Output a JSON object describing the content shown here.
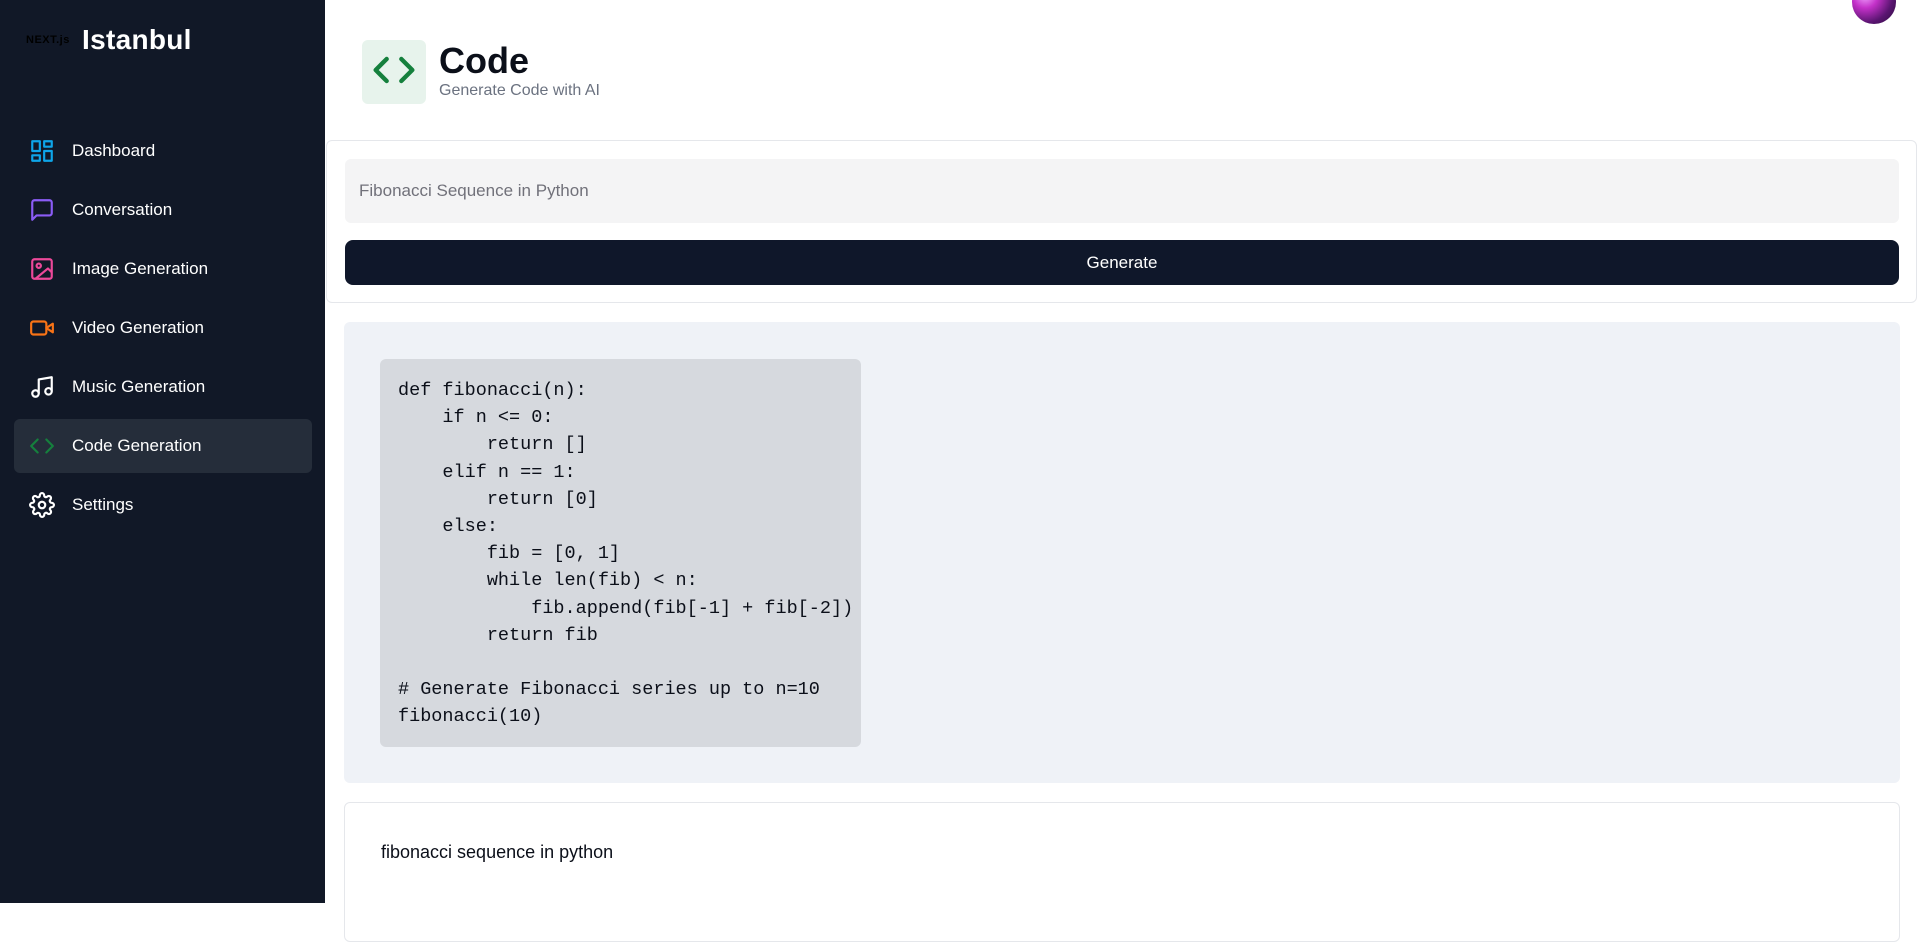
{
  "brand": {
    "logo_text": "NEXT.js",
    "name": "Istanbul"
  },
  "sidebar": {
    "items": [
      {
        "label": "Dashboard",
        "icon": "dashboard-icon",
        "color": "#0ea5e9",
        "active": false
      },
      {
        "label": "Conversation",
        "icon": "message-square-icon",
        "color": "#8b5cf6",
        "active": false
      },
      {
        "label": "Image Generation",
        "icon": "image-icon",
        "color": "#ec4899",
        "active": false
      },
      {
        "label": "Video Generation",
        "icon": "video-icon",
        "color": "#f97316",
        "active": false
      },
      {
        "label": "Music Generation",
        "icon": "music-icon",
        "color": "#ffffff",
        "active": false
      },
      {
        "label": "Code Generation",
        "icon": "code-icon",
        "color": "#15803d",
        "active": true
      },
      {
        "label": "Settings",
        "icon": "settings-icon",
        "color": "#ffffff",
        "active": false
      }
    ]
  },
  "header": {
    "title": "Code",
    "subtitle": "Generate Code with AI",
    "icon": "code-icon",
    "icon_color": "#15803d",
    "icon_bg": "#e7f3ec"
  },
  "form": {
    "placeholder": "Fibonacci Sequence in Python",
    "value": "",
    "button_label": "Generate"
  },
  "messages": [
    {
      "role": "bot",
      "type": "code",
      "content": "def fibonacci(n):\n    if n <= 0:\n        return []\n    elif n == 1:\n        return [0]\n    else:\n        fib = [0, 1]\n        while len(fib) < n:\n            fib.append(fib[-1] + fib[-2])\n        return fib\n\n# Generate Fibonacci series up to n=10\nfibonacci(10)"
    },
    {
      "role": "user",
      "content": "fibonacci sequence in python"
    }
  ],
  "colors": {
    "sidebar_bg": "#111827",
    "active_item_bg": "#252d3a",
    "button_bg": "#0f172a",
    "response_bg": "#eff2f7",
    "code_bg": "#d6d9de"
  }
}
